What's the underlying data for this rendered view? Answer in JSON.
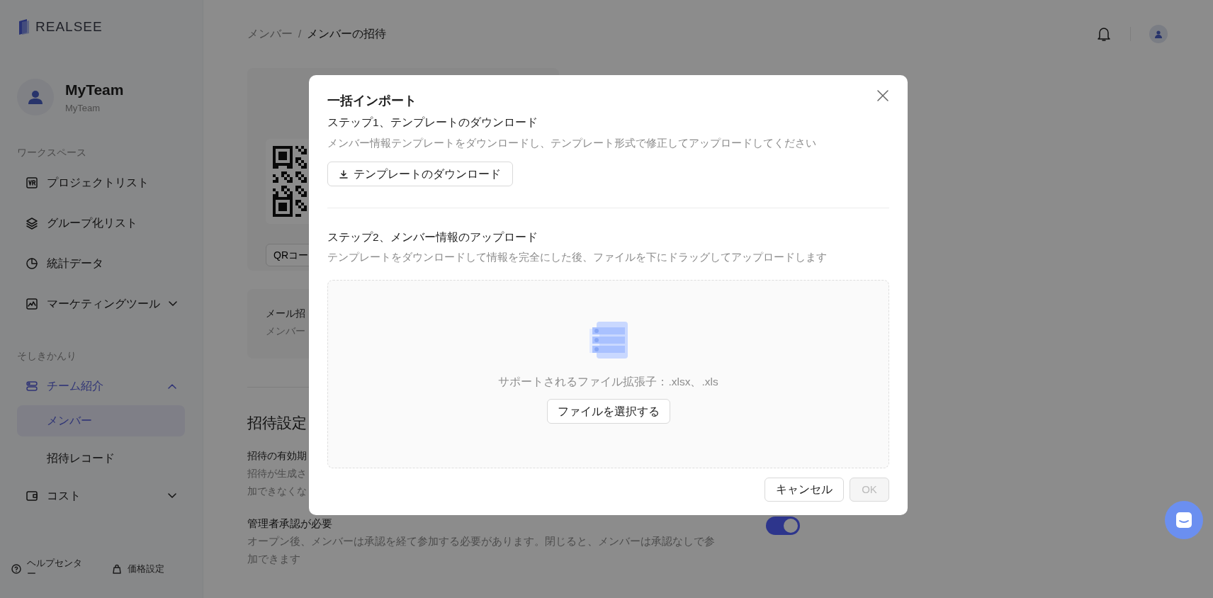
{
  "sidebar": {
    "logo": "REALSEE",
    "team": {
      "name": "MyTeam",
      "subtitle": "MyTeam"
    },
    "sections": [
      {
        "heading": "ワークスペース",
        "items": [
          {
            "label": "プロジェクトリスト",
            "selected": false
          },
          {
            "label": "グループ化リスト",
            "selected": false
          },
          {
            "label": "統計データ",
            "selected": false
          },
          {
            "label": "マーケティングツール",
            "selected": false,
            "expanded": false
          }
        ]
      },
      {
        "heading": "そしきかんり",
        "items": [
          {
            "label": "チーム紹介",
            "selected": true,
            "expanded": true,
            "children": [
              {
                "label": "メンバー",
                "selected": true
              },
              {
                "label": "招待レコード",
                "selected": false
              }
            ]
          },
          {
            "label": "コスト",
            "selected": false,
            "expanded": false
          }
        ]
      }
    ],
    "footer": {
      "help": "ヘルプセンター",
      "pricing": "価格設定"
    }
  },
  "main": {
    "breadcrumb": [
      "メンバー",
      "メンバーの招待"
    ],
    "breadcrumb_separator": "/",
    "qr_card": {
      "button": "QRコー"
    },
    "email_card": {
      "title": "メール招",
      "description": "メンバー"
    },
    "settings": {
      "heading": "招待設定",
      "items": [
        {
          "title": "招待の有効期",
          "description_lines": [
            "招待が生成さ",
            "加できなくな"
          ]
        },
        {
          "title": "管理者承認が必要",
          "description": "オープン後、メンバーは承認を経て参加する必要があります。閉じると、メンバーは承認なしで参加できます",
          "on": true
        }
      ]
    }
  },
  "modal": {
    "title": "一括インポート",
    "steps": [
      {
        "title": "ステップ1、テンプレートのダウンロード",
        "description": "メンバー情報テンプレートをダウンロードし、テンプレート形式で修正してアップロードしてください",
        "button": "テンプレートのダウンロード"
      },
      {
        "title": "ステップ2、メンバー情報のアップロード",
        "description": "テンプレートをダウンロードして情報を完全にした後、ファイルを下にドラッグしてアップロードします"
      }
    ],
    "dropzone": {
      "hint": "サポートされるファイル拡張子：.xlsx、.xls",
      "button": "ファイルを選択する"
    },
    "footer": {
      "cancel": "キャンセル",
      "ok": "OK",
      "ok_disabled": true
    }
  }
}
